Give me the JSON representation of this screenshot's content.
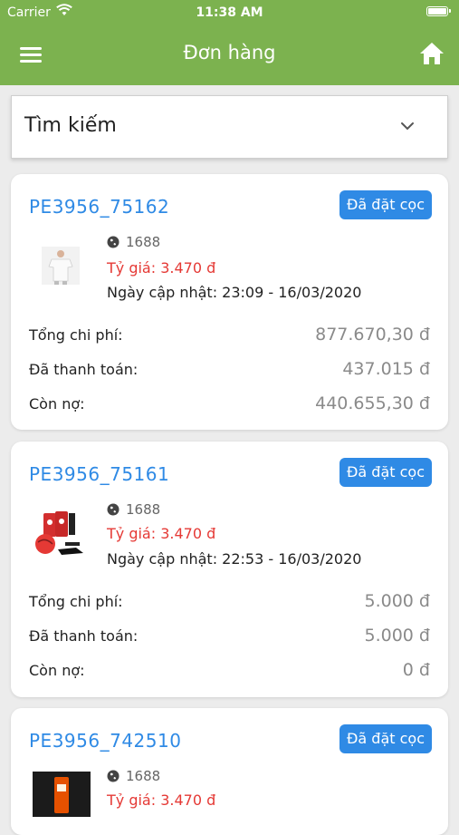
{
  "status_bar": {
    "carrier": "Carrier",
    "time": "11:38 AM"
  },
  "header": {
    "title": "Đơn hàng",
    "menu_icon": "menu-icon",
    "home_icon": "home-icon",
    "color": "#7cb24f"
  },
  "search": {
    "placeholder": "Tìm kiếm"
  },
  "labels": {
    "total": "Tổng chi phí:",
    "paid": "Đã thanh toán:",
    "owed": "Còn nợ:"
  },
  "orders": [
    {
      "code": "PE3956_75162",
      "status": "Đã đặt cọc",
      "source": "1688",
      "rate": "Tỷ giá: 3.470 đ",
      "updated": "Ngày cập nhật: 23:09 - 16/03/2020",
      "total": "877.670,30 đ",
      "paid": "437.015 đ",
      "owed": "440.655,30 đ"
    },
    {
      "code": "PE3956_75161",
      "status": "Đã đặt cọc",
      "source": "1688",
      "rate": "Tỷ giá: 3.470 đ",
      "updated": "Ngày cập nhật: 22:53 - 16/03/2020",
      "total": "5.000 đ",
      "paid": "5.000 đ",
      "owed": "0 đ"
    },
    {
      "code": "PE3956_742510",
      "status": "Đã đặt cọc",
      "source": "1688",
      "rate": "Tỷ giá: 3.470 đ"
    }
  ],
  "colors": {
    "accent_blue": "#2f8ae5",
    "rate_red": "#e53935",
    "value_grey": "#8a8a8a"
  }
}
